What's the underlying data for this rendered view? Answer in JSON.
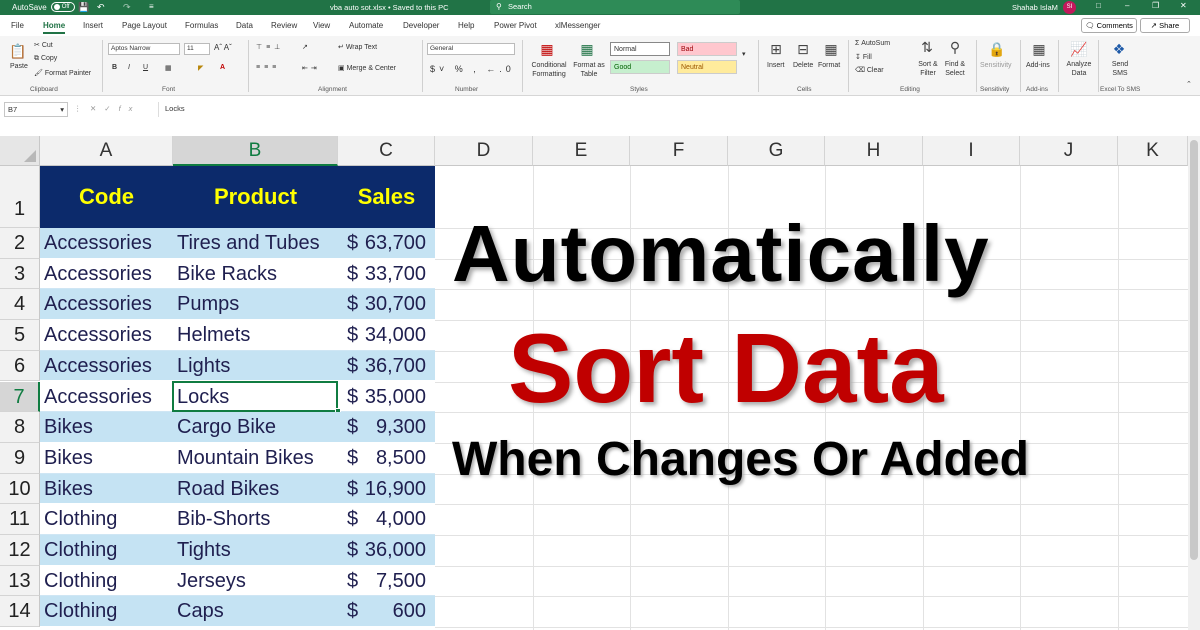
{
  "titlebar": {
    "autosave_label": "AutoSave",
    "autosave_state": "Off",
    "filename": "vba auto sot.xlsx  •  Saved to this PC",
    "search_placeholder": "Search",
    "user_name": "Shahab IslaM",
    "user_initials": "SI"
  },
  "tabs": [
    "File",
    "Home",
    "Insert",
    "Page Layout",
    "Formulas",
    "Data",
    "Review",
    "View",
    "Automate",
    "Developer",
    "Help",
    "Power Pivot",
    "xlMessenger"
  ],
  "active_tab": "Home",
  "header_buttons": {
    "comments": "Comments",
    "share": "Share"
  },
  "ribbon": {
    "clipboard": {
      "paste": "Paste",
      "cut": "Cut",
      "copy": "Copy",
      "format_painter": "Format Painter",
      "group": "Clipboard"
    },
    "font": {
      "name": "Aptos Narrow",
      "size": "11",
      "group": "Font"
    },
    "alignment": {
      "wrap": "Wrap Text",
      "merge": "Merge & Center",
      "group": "Alignment"
    },
    "number": {
      "format": "General",
      "group": "Number"
    },
    "styles": {
      "conditional": "Conditional Formatting",
      "format_table": "Format as Table",
      "normal": "Normal",
      "bad": "Bad",
      "good": "Good",
      "neutral": "Neutral",
      "group": "Styles"
    },
    "cells": {
      "insert": "Insert",
      "delete": "Delete",
      "format": "Format",
      "group": "Cells"
    },
    "editing": {
      "autosum": "AutoSum",
      "fill": "Fill",
      "clear": "Clear",
      "sort": "Sort & Filter",
      "find": "Find & Select",
      "group": "Editing"
    },
    "sensitivity": {
      "label": "Sensitivity",
      "group": "Sensitivity"
    },
    "addins": {
      "label": "Add-ins",
      "group": "Add-ins"
    },
    "analyze": {
      "label": "Analyze Data"
    },
    "sms": {
      "label": "Send SMS",
      "group": "Excel To SMS"
    },
    "colors": {
      "good_bg": "#c6efce",
      "bad_bg": "#ffc7ce",
      "neutral_bg": "#ffeb9c"
    }
  },
  "formula_bar": {
    "name_box": "B7",
    "content": "Locks"
  },
  "columns": [
    "A",
    "B",
    "C",
    "D",
    "E",
    "F",
    "G",
    "H",
    "I",
    "J",
    "K"
  ],
  "selected_column": "B",
  "selected_row": "7",
  "table": {
    "headers": [
      "Code",
      "Product",
      "Sales"
    ],
    "rows": [
      {
        "row": "2",
        "code": "Accessories",
        "product": "Tires and Tubes",
        "cur": "$",
        "sales": "63,700"
      },
      {
        "row": "3",
        "code": "Accessories",
        "product": "Bike Racks",
        "cur": "$",
        "sales": "33,700"
      },
      {
        "row": "4",
        "code": "Accessories",
        "product": "Pumps",
        "cur": "$",
        "sales": "30,700"
      },
      {
        "row": "5",
        "code": "Accessories",
        "product": "Helmets",
        "cur": "$",
        "sales": "34,000"
      },
      {
        "row": "6",
        "code": "Accessories",
        "product": "Lights",
        "cur": "$",
        "sales": "36,700"
      },
      {
        "row": "7",
        "code": "Accessories",
        "product": "Locks",
        "cur": "$",
        "sales": "35,000"
      },
      {
        "row": "8",
        "code": "Bikes",
        "product": "Cargo Bike",
        "cur": "$",
        "sales": "9,300"
      },
      {
        "row": "9",
        "code": "Bikes",
        "product": "Mountain Bikes",
        "cur": "$",
        "sales": "8,500"
      },
      {
        "row": "10",
        "code": "Bikes",
        "product": "Road Bikes",
        "cur": "$",
        "sales": "16,900"
      },
      {
        "row": "11",
        "code": "Clothing",
        "product": "Bib-Shorts",
        "cur": "$",
        "sales": "4,000"
      },
      {
        "row": "12",
        "code": "Clothing",
        "product": "Tights",
        "cur": "$",
        "sales": "36,000"
      },
      {
        "row": "13",
        "code": "Clothing",
        "product": "Jerseys",
        "cur": "$",
        "sales": "7,500"
      },
      {
        "row": "14",
        "code": "Clothing",
        "product": "Caps",
        "cur": "$",
        "sales": "600"
      }
    ],
    "header_row": "1",
    "header_bg": "#0c2a6b",
    "header_text_color": "#ffff00",
    "band_color": "#c5e3f3"
  },
  "overlay": {
    "line1": "Automatically",
    "line2": "Sort Data",
    "line3": "When Changes Or Added",
    "line2_color": "#c00000"
  }
}
